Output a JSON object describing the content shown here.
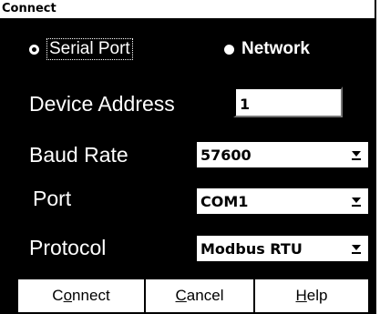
{
  "window": {
    "title": "Connect"
  },
  "connection_type": {
    "options": [
      {
        "label": "Serial Port",
        "selected": true
      },
      {
        "label": "Network",
        "selected": false
      }
    ]
  },
  "fields": {
    "device_address": {
      "label": "Device Address",
      "value": "1"
    },
    "baud_rate": {
      "label": "Baud Rate",
      "value": "57600"
    },
    "port": {
      "label": "Port",
      "value": "COM1"
    },
    "protocol": {
      "label": "Protocol",
      "value": "Modbus RTU"
    }
  },
  "buttons": {
    "connect": {
      "label": "Connect",
      "mnemonic_index": 1
    },
    "cancel": {
      "label": "Cancel",
      "mnemonic_index": 0
    },
    "help": {
      "label": "Help",
      "mnemonic_index": 0
    }
  },
  "colors": {
    "background": "#000000",
    "foreground": "#ffffff"
  },
  "icons": {
    "dropdown": "chevron-down-underline-icon",
    "radio": "radio-dot-icon"
  }
}
